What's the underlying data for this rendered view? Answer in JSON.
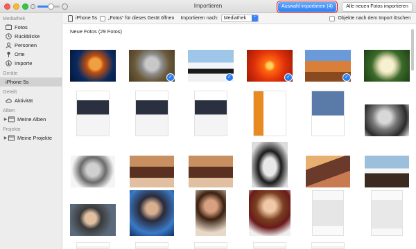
{
  "window": {
    "title": "Importieren",
    "import_selected_label": "Auswahl importieren (4)",
    "import_all_label": "Alle neuen Fotos importieren",
    "thumbnail_size_fraction": 0.6,
    "highlight_color": "#e0101a",
    "accent_color": "#2f7ff1"
  },
  "sidebar": {
    "sections": [
      {
        "title": "Mediathek",
        "items": [
          {
            "label": "Fotos",
            "icon": "photos-icon"
          },
          {
            "label": "Rückblicke",
            "icon": "memories-icon"
          },
          {
            "label": "Personen",
            "icon": "person-icon"
          },
          {
            "label": "Orte",
            "icon": "pin-icon"
          },
          {
            "label": "Importe",
            "icon": "import-icon"
          }
        ]
      },
      {
        "title": "Geräte",
        "items": [
          {
            "label": "iPhone 5s",
            "icon": "",
            "selected": true
          }
        ]
      },
      {
        "title": "Geteilt",
        "items": [
          {
            "label": "Aktivität",
            "icon": "cloud-icon"
          }
        ]
      },
      {
        "title": "Alben",
        "items": [
          {
            "label": "Meine Alben",
            "icon": "album-icon",
            "disclosure": true
          }
        ]
      },
      {
        "title": "Projekte",
        "items": [
          {
            "label": "Meine Projekte",
            "icon": "album-icon",
            "disclosure": true
          }
        ]
      }
    ]
  },
  "toolbar": {
    "device": "iPhone 5s",
    "open_photos_label": "„Fotos“ für dieses Gerät öffnen",
    "import_to_label": "Importieren nach:",
    "import_to_value": "Mediathek",
    "delete_after_label": "Objekte nach dem Import löschen"
  },
  "main": {
    "heading": "Neue Fotos (29 Fotos)",
    "photos": [
      {
        "name": "jellyfish",
        "selected": false
      },
      {
        "name": "koala",
        "selected": true
      },
      {
        "name": "penguins",
        "selected": true
      },
      {
        "name": "orange-flower",
        "selected": true
      },
      {
        "name": "desert-rocks",
        "selected": true
      },
      {
        "name": "white-flower",
        "selected": false
      },
      {
        "name": "screenshot-app",
        "selected": false
      },
      {
        "name": "screenshot-app",
        "selected": false
      },
      {
        "name": "screenshot-app",
        "selected": false
      },
      {
        "name": "screenshot-web",
        "selected": false
      },
      {
        "name": "screenshot-penguins",
        "selected": false
      },
      {
        "name": "portrait-bw",
        "selected": false
      },
      {
        "name": "portrait-bw-2",
        "selected": false
      },
      {
        "name": "titanic",
        "selected": false
      },
      {
        "name": "titanic",
        "selected": false
      },
      {
        "name": "audrey-hepburn",
        "selected": false
      },
      {
        "name": "titanic-couple",
        "selected": false
      },
      {
        "name": "titanic-ship",
        "selected": false
      },
      {
        "name": "harry-potter",
        "selected": false
      },
      {
        "name": "harry-potter-2",
        "selected": false
      },
      {
        "name": "angelina",
        "selected": false
      },
      {
        "name": "hermione",
        "selected": false
      },
      {
        "name": "settings-screen",
        "selected": false
      },
      {
        "name": "settings-screen-2",
        "selected": false
      },
      {
        "name": "screenshot-strip",
        "selected": false
      },
      {
        "name": "screenshot-strip",
        "selected": false
      },
      {
        "name": "screenshot-strip",
        "selected": false
      },
      {
        "name": "screenshot-strip",
        "selected": false
      },
      {
        "name": "screenshot-strip",
        "selected": false
      }
    ]
  }
}
